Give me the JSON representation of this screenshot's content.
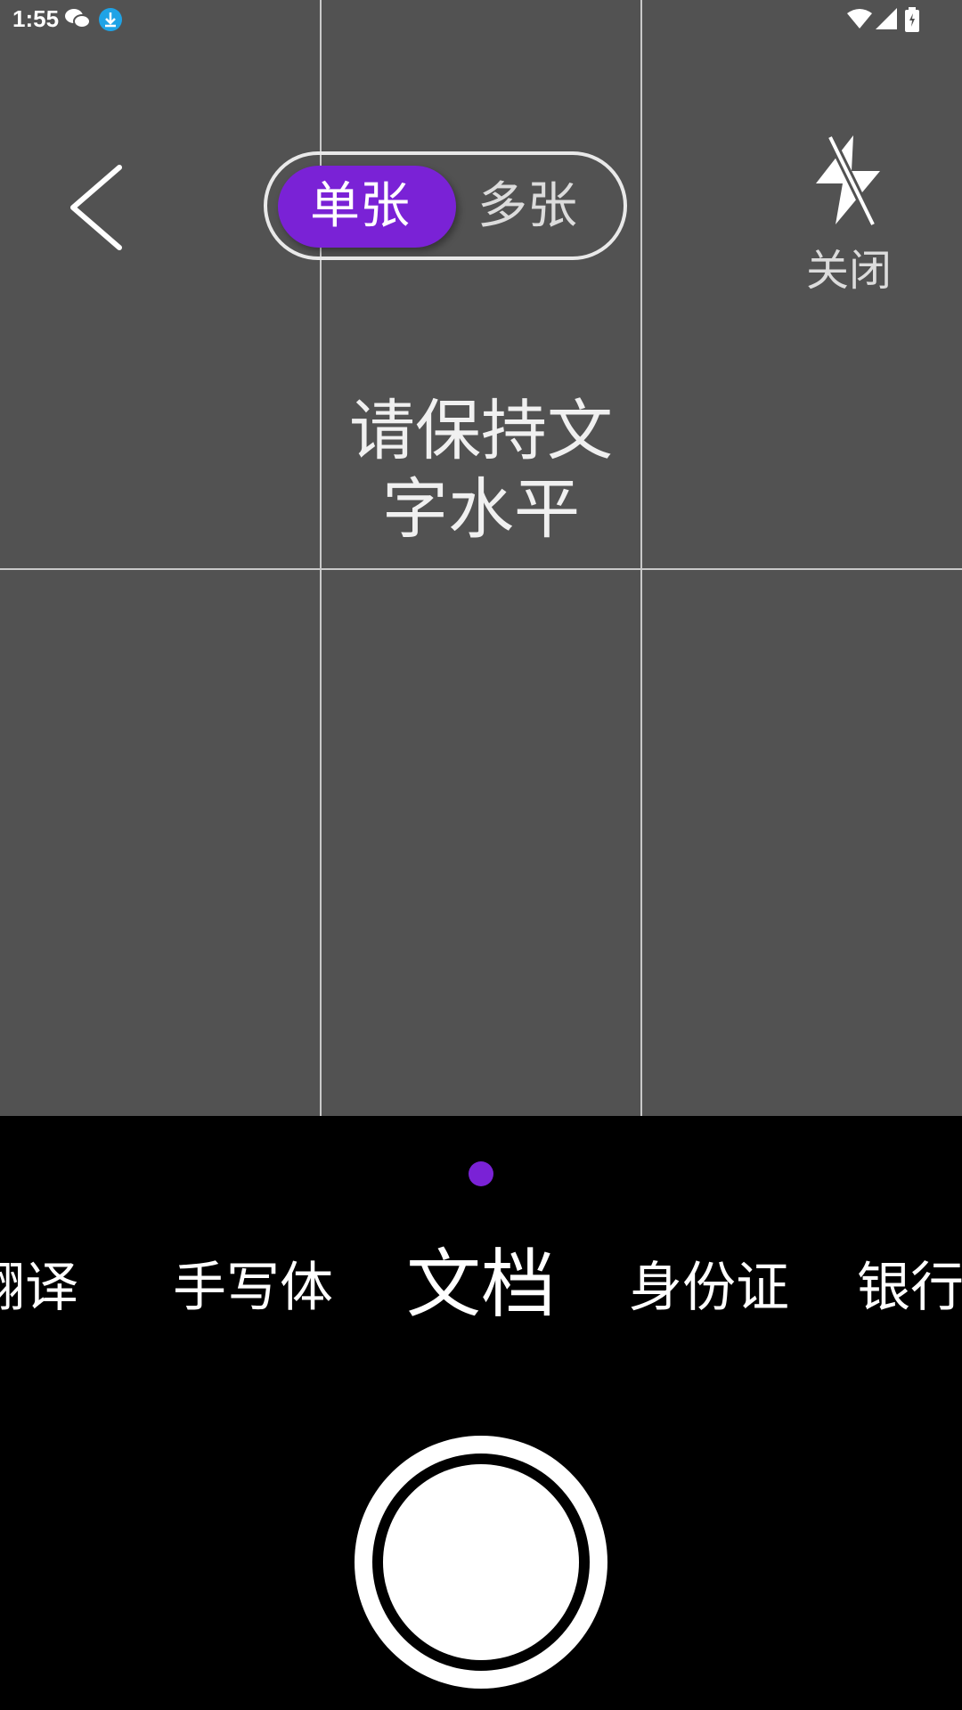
{
  "status_bar": {
    "time": "1:55",
    "icons": [
      "wechat-icon",
      "download-icon",
      "wifi-icon",
      "signal-icon",
      "battery-icon"
    ]
  },
  "top_bar": {
    "back_icon": "chevron-left-icon",
    "mode_toggle": {
      "single_label": "单张",
      "multi_label": "多张",
      "selected": "单张"
    },
    "flash": {
      "icon": "flash-off-icon",
      "label": "关闭"
    }
  },
  "preview": {
    "hint_line1": "请保持文",
    "hint_line2": "字水平"
  },
  "colors": {
    "accent": "#7a22d6",
    "preview_bg": "#525252",
    "panel_bg": "#000000"
  },
  "mode_tabs": {
    "items": [
      {
        "label": "翻译"
      },
      {
        "label": "手写体"
      },
      {
        "label": "文档"
      },
      {
        "label": "身份证"
      },
      {
        "label": "银行卡"
      }
    ],
    "active": "文档"
  },
  "shutter": {
    "icon": "shutter-button"
  }
}
